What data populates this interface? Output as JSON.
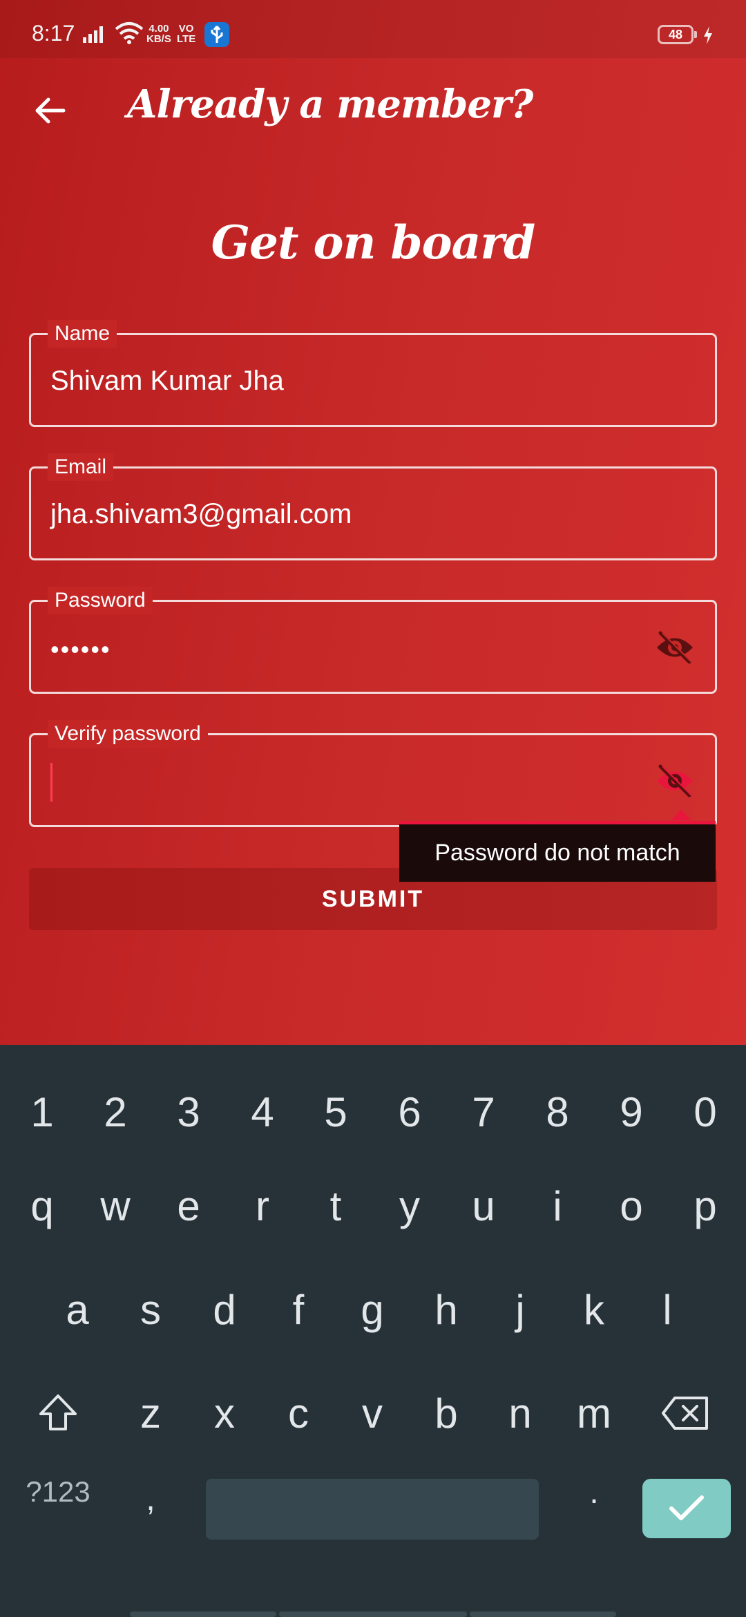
{
  "status_bar": {
    "time": "8:17",
    "network_speed_value": "4.00",
    "network_speed_unit": "KB/S",
    "volte_top": "VO",
    "volte_bottom": "LTE",
    "battery": "48"
  },
  "header": {
    "title": "Already a member?"
  },
  "heading": "Get on board",
  "form": {
    "name": {
      "label": "Name",
      "value": "Shivam Kumar Jha"
    },
    "email": {
      "label": "Email",
      "value": "jha.shivam3@gmail.com"
    },
    "password": {
      "label": "Password",
      "value": "••••••"
    },
    "verify_password": {
      "label": "Verify password",
      "value": ""
    },
    "error_message": "Password do not match",
    "submit_label": "SUBMIT"
  },
  "colors": {
    "accent_error": "#e8163c",
    "app_background": "#c62828",
    "keyboard_background": "#263238",
    "enter_key": "#80cbc4"
  },
  "keyboard": {
    "number_row": [
      "1",
      "2",
      "3",
      "4",
      "5",
      "6",
      "7",
      "8",
      "9",
      "0"
    ],
    "row1": [
      "q",
      "w",
      "e",
      "r",
      "t",
      "y",
      "u",
      "i",
      "o",
      "p"
    ],
    "row2": [
      "a",
      "s",
      "d",
      "f",
      "g",
      "h",
      "j",
      "k",
      "l"
    ],
    "row3": [
      "z",
      "x",
      "c",
      "v",
      "b",
      "n",
      "m"
    ],
    "symbols_key": "?123",
    "comma_key": ",",
    "period_key": "."
  }
}
